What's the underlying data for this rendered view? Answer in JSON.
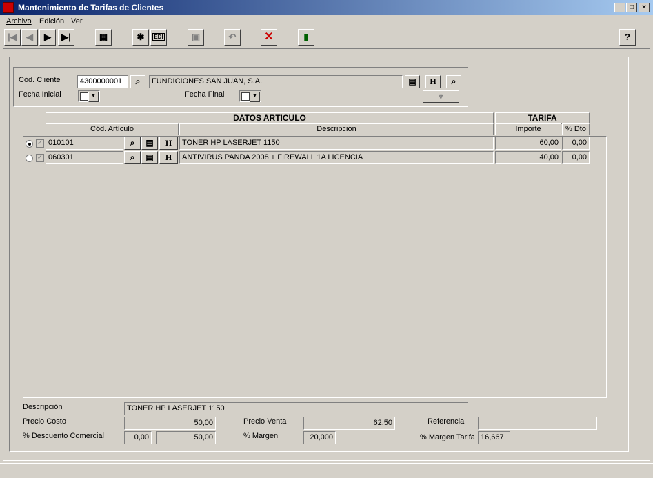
{
  "window": {
    "title": "Mantenimiento de Tarifas de Clientes",
    "controls": [
      "_",
      "□",
      "×"
    ]
  },
  "menu": [
    "Archivo",
    "Edición",
    "Ver"
  ],
  "toolbar": {
    "edit_label": "EDI"
  },
  "filter": {
    "cliente_label": "Cód. Cliente",
    "cliente_code": "4300000001",
    "cliente_name": "FUNDICIONES SAN JUAN, S.A.",
    "fecha_inicial_label": "Fecha Inicial",
    "fecha_final_label": "Fecha Final",
    "h_label": "H"
  },
  "grid": {
    "group_articulo": "DATOS ARTICULO",
    "group_tarifa": "TARIFA",
    "col_codigo": "Cód. Artículo",
    "col_descripcion": "Descripción",
    "col_importe": "Importe",
    "col_dto": "% Dto",
    "rows": [
      {
        "codigo": "010101",
        "descripcion": "TONER HP LASERJET 1150",
        "importe": "60,00",
        "dto": "0,00",
        "selected": true
      },
      {
        "codigo": "060301",
        "descripcion": "ANTIVIRUS PANDA 2008 + FIREWALL 1A LICENCIA",
        "importe": "40,00",
        "dto": "0,00",
        "selected": false
      }
    ]
  },
  "details": {
    "descripcion_label": "Descripción",
    "descripcion_value": "TONER HP LASERJET 1150",
    "precio_costo_label": "Precio Costo",
    "precio_costo_value": "50,00",
    "precio_venta_label": "Precio Venta",
    "precio_venta_value": "62,50",
    "referencia_label": "Referencia",
    "referencia_value": "",
    "descuento_label": "% Descuento Comercial",
    "descuento_value": "0,00",
    "descuento_importe": "50,00",
    "margen_label": "% Margen",
    "margen_value": "20,000",
    "margen_tarifa_label": "% Margen Tarifa",
    "margen_tarifa_value": "16,667"
  },
  "icons": {
    "first": "first-record-icon",
    "prev": "previous-record-icon",
    "next": "next-record-icon",
    "last": "last-record-icon",
    "calc": "calculator-icon",
    "new": "new-record-icon",
    "edit": "edit-record-icon",
    "save": "save-icon",
    "undo": "undo-icon",
    "delete": "delete-icon",
    "exit": "exit-door-icon",
    "help": "help-icon"
  }
}
